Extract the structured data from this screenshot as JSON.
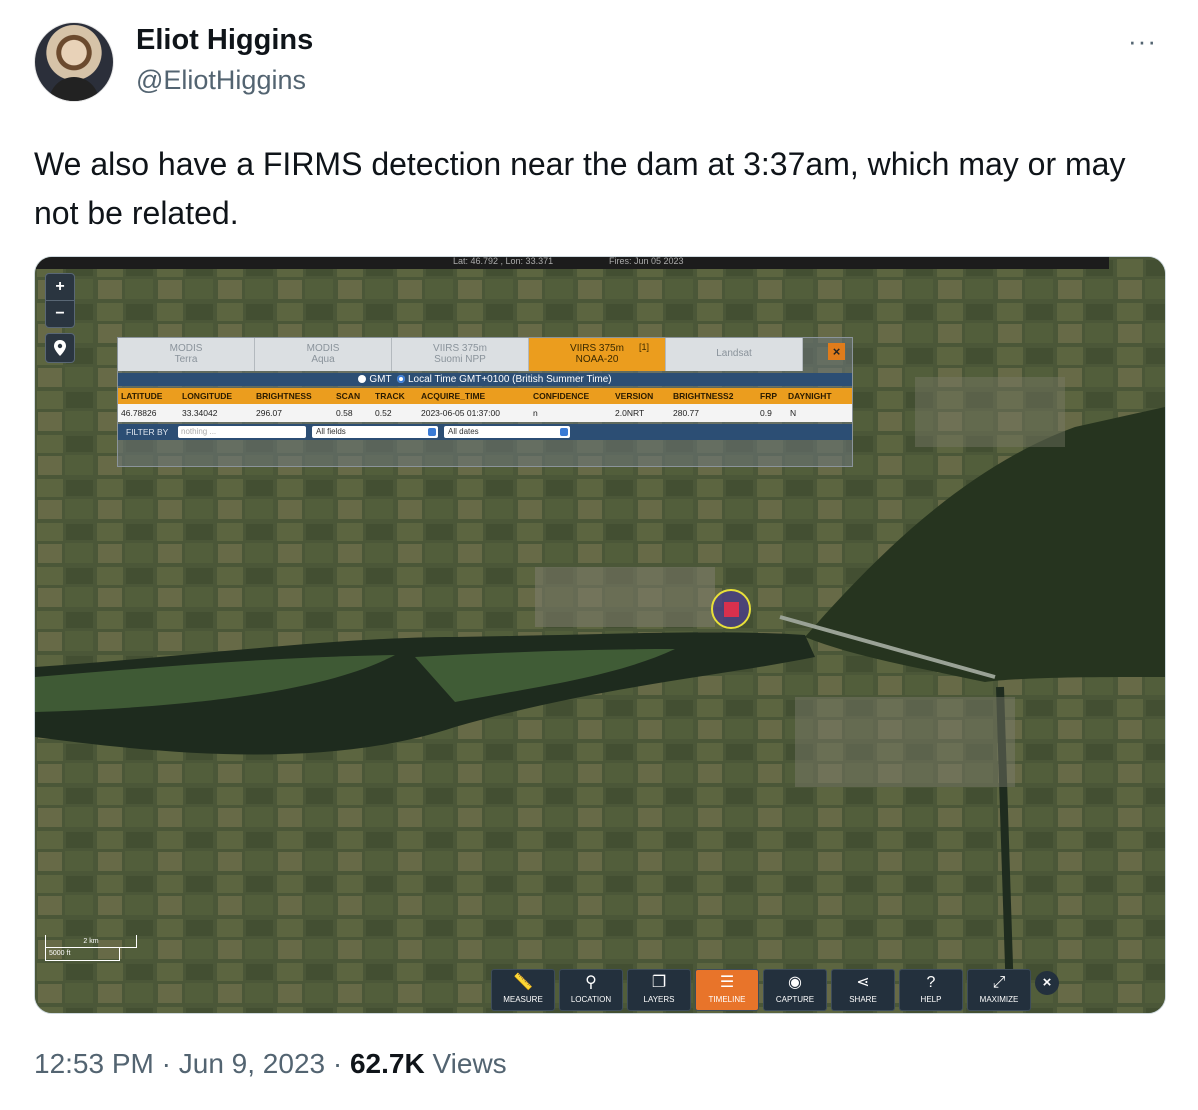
{
  "author": {
    "name": "Eliot Higgins",
    "handle": "@EliotHiggins"
  },
  "tweet": {
    "more_label": "···",
    "text": "We also have a FIRMS detection near the dam at 3:37am, which may or may not be related."
  },
  "map": {
    "topbar": {
      "coords": "Lat: 46.792 , Lon: 33.371",
      "fires": "Fires: Jun 05 2023"
    },
    "zoom_in": "+",
    "zoom_out": "−",
    "scale_km": "2 km",
    "scale_ft": "5000 ft",
    "panel": {
      "tabs": [
        {
          "line1": "MODIS",
          "line2": "Terra"
        },
        {
          "line1": "MODIS",
          "line2": "Aqua"
        },
        {
          "line1": "VIIRS 375m",
          "line2": "Suomi NPP"
        },
        {
          "line1": "VIIRS 375m",
          "line2": "NOAA-20",
          "badge": "[1]"
        },
        {
          "line1": "Landsat",
          "line2": ""
        }
      ],
      "close": "×",
      "time_gmt": "GMT",
      "time_local": "Local Time GMT+0100 (British Summer Time)",
      "headers": [
        "LATITUDE",
        "LONGITUDE",
        "BRIGHTNESS",
        "SCAN",
        "TRACK",
        "ACQUIRE_TIME",
        "CONFIDENCE",
        "VERSION",
        "BRIGHTNESS2",
        "FRP",
        "DAYNIGHT"
      ],
      "row": [
        "46.78826",
        "33.34042",
        "296.07",
        "0.58",
        "0.52",
        "2023-06-05 01:37:00",
        "n",
        "2.0NRT",
        "280.77",
        "0.9",
        "N"
      ],
      "filter_label": "FILTER BY",
      "filter_placeholder": "nothing ...",
      "field_select": "All fields",
      "date_select": "All dates"
    },
    "toolbar": [
      {
        "label": "MEASURE",
        "icon": "ruler-icon"
      },
      {
        "label": "LOCATION",
        "icon": "pin-icon"
      },
      {
        "label": "LAYERS",
        "icon": "layers-icon"
      },
      {
        "label": "TIMELINE",
        "icon": "sliders-icon",
        "active": true
      },
      {
        "label": "CAPTURE",
        "icon": "camera-icon"
      },
      {
        "label": "SHARE",
        "icon": "share-icon"
      },
      {
        "label": "HELP",
        "icon": "help-icon"
      },
      {
        "label": "MAXIMIZE",
        "icon": "expand-icon"
      }
    ],
    "toolbar_close": "×"
  },
  "footer": {
    "time": "12:53 PM",
    "date": "Jun 9, 2023",
    "separator": "·",
    "views": "62.7K",
    "views_label": "Views"
  }
}
